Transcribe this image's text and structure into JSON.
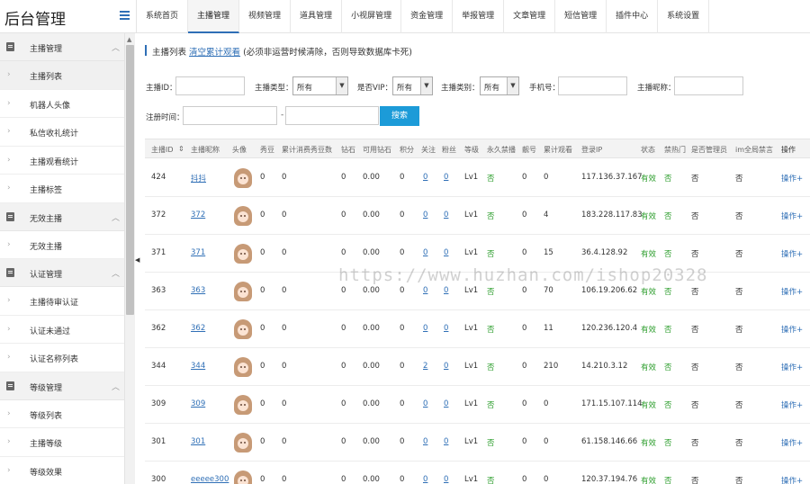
{
  "app": {
    "title": "后台管理"
  },
  "nav": [
    "系统首页",
    "主播管理",
    "视频管理",
    "道具管理",
    "小视屏管理",
    "资金管理",
    "举报管理",
    "文章管理",
    "短信管理",
    "插件中心",
    "系统设置"
  ],
  "nav_active": 1,
  "sidebar": [
    {
      "type": "group",
      "label": "主播管理"
    },
    {
      "type": "item",
      "label": "主播列表",
      "active": true
    },
    {
      "type": "item",
      "label": "机器人头像"
    },
    {
      "type": "item",
      "label": "私信收礼统计"
    },
    {
      "type": "item",
      "label": "主播观看统计"
    },
    {
      "type": "item",
      "label": "主播标签"
    },
    {
      "type": "group",
      "label": "无效主播"
    },
    {
      "type": "item",
      "label": "无效主播"
    },
    {
      "type": "group",
      "label": "认证管理"
    },
    {
      "type": "item",
      "label": "主播待审认证"
    },
    {
      "type": "item",
      "label": "认证未通过"
    },
    {
      "type": "item",
      "label": "认证名称列表"
    },
    {
      "type": "group",
      "label": "等级管理"
    },
    {
      "type": "item",
      "label": "等级列表"
    },
    {
      "type": "item",
      "label": "主播等级"
    },
    {
      "type": "item",
      "label": "等级效果"
    }
  ],
  "page": {
    "title": "主播列表",
    "clear_link": "清空累计观看",
    "note": "(必须非运营时候清除，否则导致数据库卡死)"
  },
  "filters": {
    "anchor_id_label": "主播ID：",
    "anchor_type_label": "主播类型：",
    "anchor_type_value": "所有",
    "vip_label": "是否VIP：",
    "vip_value": "所有",
    "category_label": "主播类别：",
    "category_value": "所有",
    "phone_label": "手机号：",
    "nickname_label": "主播昵称：",
    "reg_time_label": "注册时间：",
    "dash": "-",
    "search_button": "搜索"
  },
  "table": {
    "headers": [
      "主播ID",
      "主播昵称",
      "头像",
      "秀豆",
      "累计消费秀豆数",
      "钻石",
      "可用钻石",
      "积分",
      "关注",
      "粉丝",
      "等级",
      "永久禁播",
      "靓号",
      "累计观看",
      "登录IP",
      "状态",
      "禁热门",
      "是否管理员",
      "im全局禁言",
      "操作"
    ],
    "sort_icon": "⇕",
    "rows": [
      [
        "424",
        "抖抖",
        "0",
        "0",
        "0",
        "0.00",
        "0",
        "0",
        "0",
        "Lv1",
        "否",
        "0",
        "0",
        "117.136.37.167",
        "有效",
        "否",
        "否",
        "否",
        "操作+"
      ],
      [
        "372",
        "372",
        "0",
        "0",
        "0",
        "0.00",
        "0",
        "0",
        "0",
        "Lv1",
        "否",
        "0",
        "4",
        "183.228.117.83",
        "有效",
        "否",
        "否",
        "否",
        "操作+"
      ],
      [
        "371",
        "371",
        "0",
        "0",
        "0",
        "0.00",
        "0",
        "0",
        "0",
        "Lv1",
        "否",
        "0",
        "15",
        "36.4.128.92",
        "有效",
        "否",
        "否",
        "否",
        "操作+"
      ],
      [
        "363",
        "363",
        "0",
        "0",
        "0",
        "0.00",
        "0",
        "0",
        "0",
        "Lv1",
        "否",
        "0",
        "70",
        "106.19.206.62",
        "有效",
        "否",
        "否",
        "否",
        "操作+"
      ],
      [
        "362",
        "362",
        "0",
        "0",
        "0",
        "0.00",
        "0",
        "0",
        "0",
        "Lv1",
        "否",
        "0",
        "11",
        "120.236.120.4",
        "有效",
        "否",
        "否",
        "否",
        "操作+"
      ],
      [
        "344",
        "344",
        "0",
        "0",
        "0",
        "0.00",
        "0",
        "2",
        "0",
        "Lv1",
        "否",
        "0",
        "210",
        "14.210.3.12",
        "有效",
        "否",
        "否",
        "否",
        "操作+"
      ],
      [
        "309",
        "309",
        "0",
        "0",
        "0",
        "0.00",
        "0",
        "0",
        "0",
        "Lv1",
        "否",
        "0",
        "0",
        "171.15.107.114",
        "有效",
        "否",
        "否",
        "否",
        "操作+"
      ],
      [
        "301",
        "301",
        "0",
        "0",
        "0",
        "0.00",
        "0",
        "0",
        "0",
        "Lv1",
        "否",
        "0",
        "0",
        "61.158.146.66",
        "有效",
        "否",
        "否",
        "否",
        "操作+"
      ],
      [
        "300",
        "eeeee300",
        "0",
        "0",
        "0",
        "0.00",
        "0",
        "0",
        "0",
        "Lv1",
        "否",
        "0",
        "0",
        "120.37.194.76",
        "有效",
        "否",
        "否",
        "否",
        "操作+"
      ]
    ]
  },
  "watermark": "https://www.huzhan.com/ishop20328",
  "colors": {
    "accent": "#2f6fb6",
    "search": "#1c9bd8",
    "green": "#2e9e2e"
  }
}
